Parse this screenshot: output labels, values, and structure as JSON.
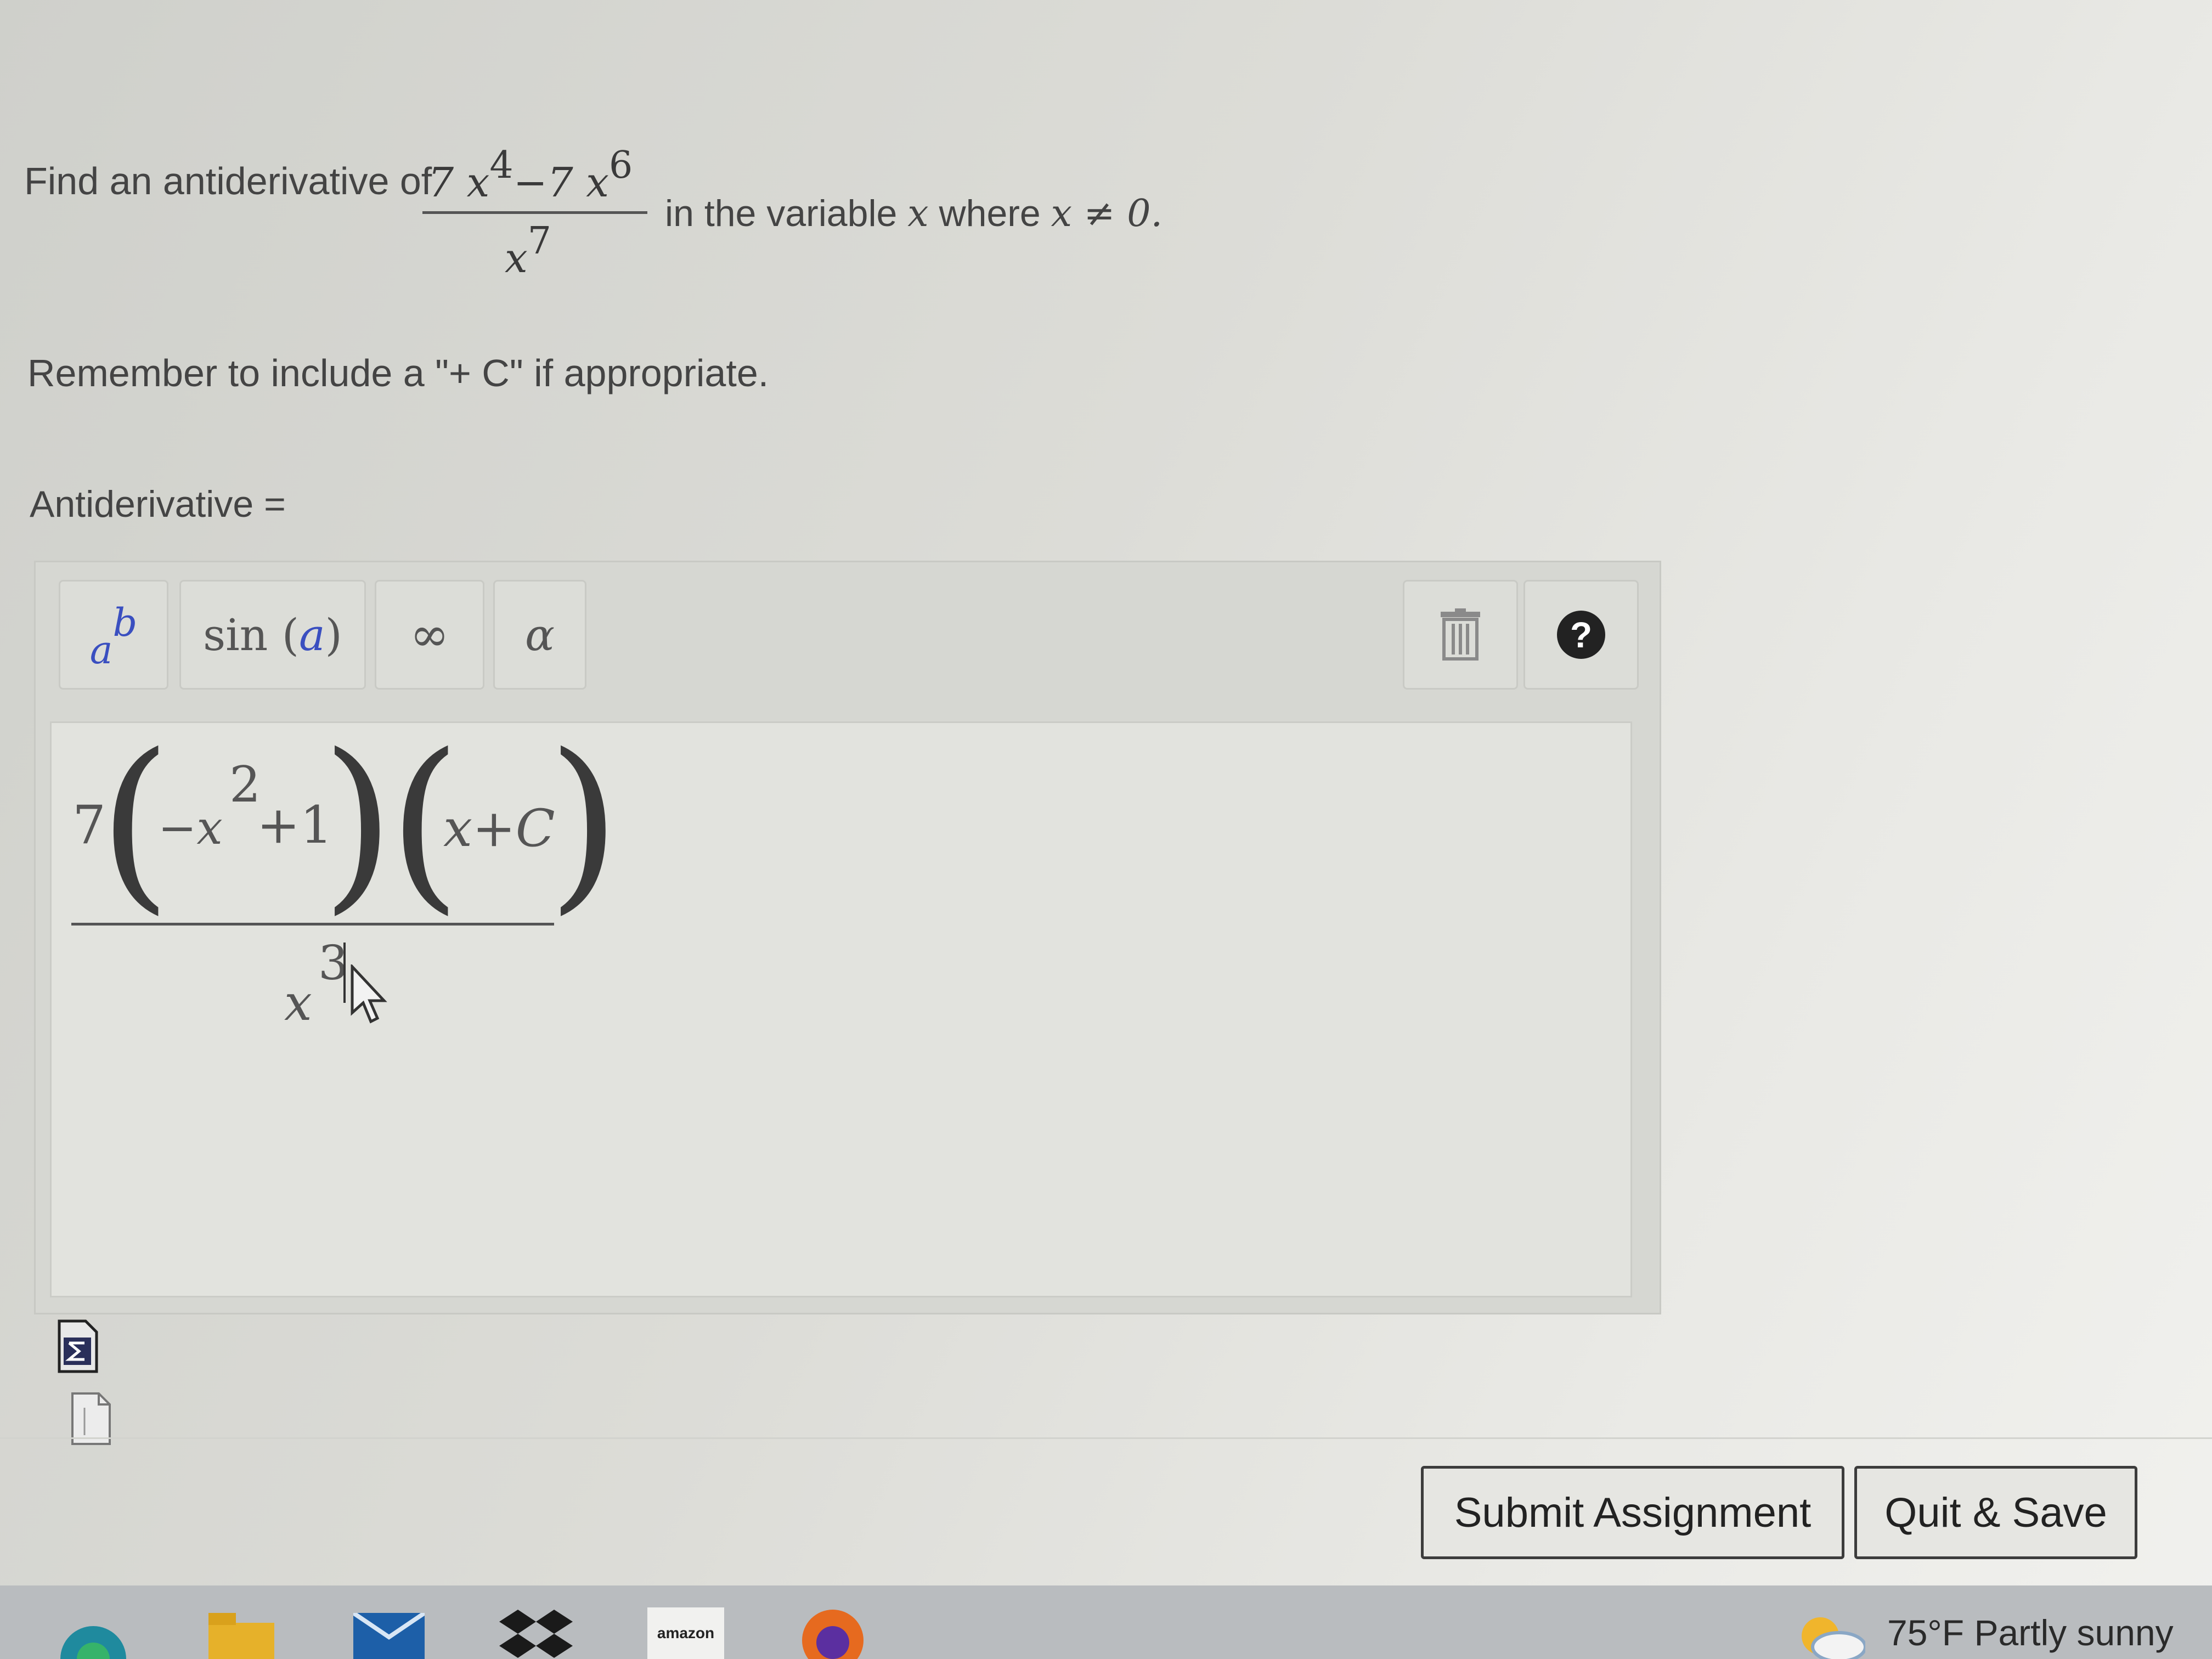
{
  "question": {
    "intro": "Find an antiderivative of",
    "numerator": {
      "coef1": "7",
      "var1": "x",
      "exp1": "4",
      "minus": "−7",
      "var2": "x",
      "exp2": "6"
    },
    "denominator": {
      "var": "x",
      "exp": "7"
    },
    "tail_text": "in the variable",
    "tail_var": "x",
    "tail_where": "where",
    "tail_cond": "x ≠ 0."
  },
  "reminder": "Remember to include a \"+ C\" if appropriate.",
  "answer_label": "Antiderivative =",
  "toolbar": {
    "power_base": "a",
    "power_exp": "b",
    "sin_func": "sin (",
    "sin_arg": "a",
    "sin_close": ")",
    "infinity": "∞",
    "alpha": "α",
    "trash_icon": "trash-icon",
    "help_symbol": "?"
  },
  "answer": {
    "coef": "7",
    "term1": "−x",
    "term1_exp": "2",
    "term1_tail": "+1",
    "term2": "x+C",
    "den_var": "x",
    "den_exp": "3"
  },
  "buttons": {
    "submit": "Submit Assignment",
    "quit": "Quit & Save"
  },
  "taskbar": {
    "amazon_label": "amazon",
    "weather": "75°F  Partly sunny"
  },
  "colors": {
    "accent_blue": "#3a4fc0",
    "background": "#dcdcd7"
  }
}
